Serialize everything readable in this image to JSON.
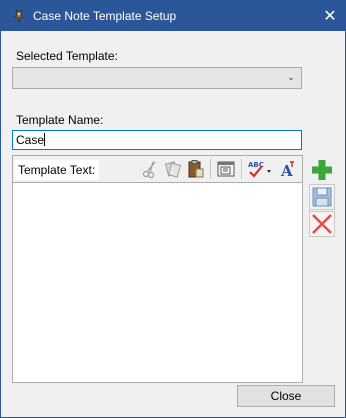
{
  "window": {
    "title": "Case Note Template Setup",
    "close_glyph": "✕",
    "icon": "app-icon"
  },
  "form": {
    "selected_template_label": "Selected Template:",
    "selected_template_value": "",
    "dropdown_glyph": "⌄",
    "template_name_label": "Template Name:",
    "template_name_value": "Case",
    "template_text_label": "Template Text:",
    "template_text_value": ""
  },
  "toolbar": {
    "icons": [
      "cut-icon",
      "copy-icon",
      "paste-icon",
      "insert-date-icon",
      "spell-check-icon",
      "font-icon"
    ]
  },
  "side_buttons": {
    "icons": [
      "add-icon",
      "save-icon",
      "delete-icon"
    ],
    "colors": {
      "add": "#3ca53c",
      "save": "#6f8fb8",
      "delete": "#e05050"
    }
  },
  "footer": {
    "close_label": "Close"
  },
  "colors": {
    "titlebar": "#2b579a",
    "focus_border": "#0078d7",
    "window_bg": "#f0f0f0"
  }
}
